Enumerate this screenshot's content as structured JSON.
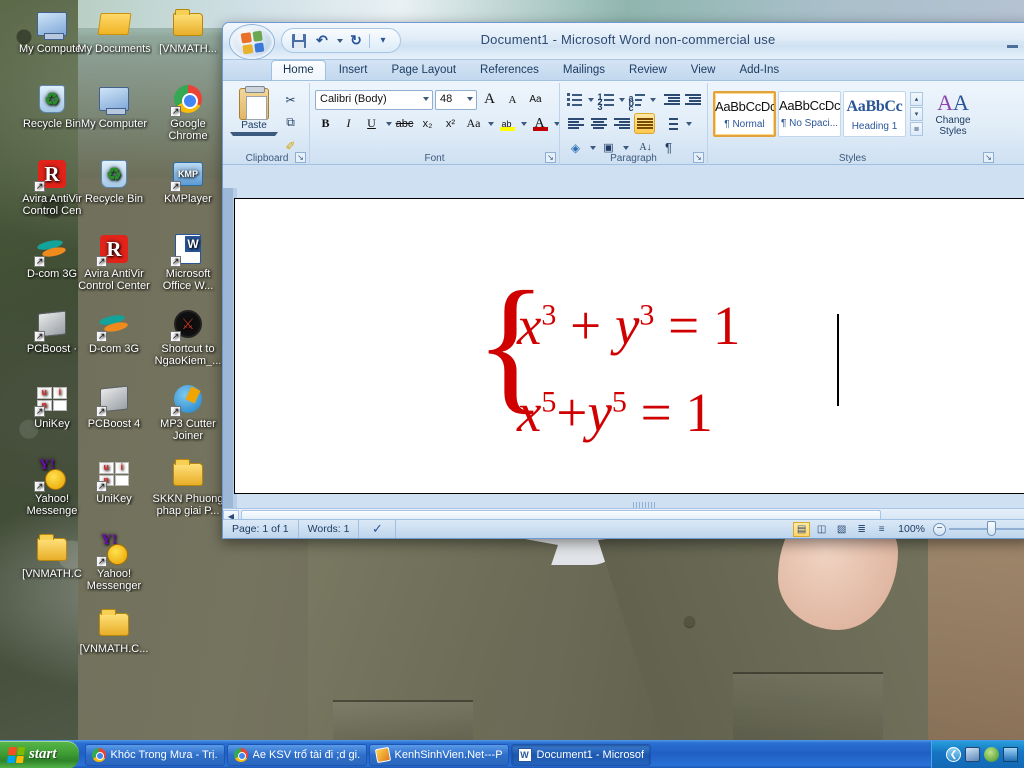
{
  "desktop": {
    "icons": [
      {
        "label": "My Computer",
        "icon": "computer-icon",
        "shortcut": false,
        "col": 0,
        "row": 0
      },
      {
        "label": "My Documents",
        "icon": "folder-open-icon",
        "shortcut": false,
        "col": 1,
        "row": 0
      },
      {
        "label": "[VNMATH...",
        "icon": "folder-icon",
        "shortcut": false,
        "col": 2,
        "row": 0
      },
      {
        "label": "Recycle Bin",
        "icon": "recycle-bin-icon",
        "shortcut": false,
        "col": 0,
        "row": 1
      },
      {
        "label": "My Computer",
        "icon": "computer-icon",
        "shortcut": false,
        "col": 1,
        "row": 1
      },
      {
        "label": "Google Chrome",
        "icon": "chrome-icon",
        "shortcut": true,
        "col": 2,
        "row": 1
      },
      {
        "label": "Avira AntiVir Control Cen",
        "icon": "avira-icon",
        "shortcut": true,
        "col": 0,
        "row": 2
      },
      {
        "label": "Recycle Bin",
        "icon": "recycle-bin-icon",
        "shortcut": false,
        "col": 1,
        "row": 2
      },
      {
        "label": "KMPlayer",
        "icon": "kmplayer-icon",
        "shortcut": true,
        "col": 2,
        "row": 2
      },
      {
        "label": "D-com 3G",
        "icon": "dcom-icon",
        "shortcut": true,
        "col": 0,
        "row": 3
      },
      {
        "label": "Avira AntiVir Control Center",
        "icon": "avira-icon",
        "shortcut": true,
        "col": 1,
        "row": 3
      },
      {
        "label": "Microsoft Office W...",
        "icon": "word-icon",
        "shortcut": true,
        "col": 2,
        "row": 3
      },
      {
        "label": "PCBoost ·",
        "icon": "pcboost-icon",
        "shortcut": true,
        "col": 0,
        "row": 4
      },
      {
        "label": "D-com 3G",
        "icon": "dcom-icon",
        "shortcut": true,
        "col": 1,
        "row": 4
      },
      {
        "label": "Shortcut to NgaoKiem_...",
        "icon": "ngaokiem-icon",
        "shortcut": true,
        "col": 2,
        "row": 4
      },
      {
        "label": "UniKey",
        "icon": "unikey-icon",
        "shortcut": true,
        "col": 0,
        "row": 5
      },
      {
        "label": "PCBoost 4",
        "icon": "pcboost-icon",
        "shortcut": true,
        "col": 1,
        "row": 5
      },
      {
        "label": "MP3 Cutter Joiner",
        "icon": "mp3-cutter-icon",
        "shortcut": true,
        "col": 2,
        "row": 5
      },
      {
        "label": "Yahoo! Messenge",
        "icon": "yahoo-icon",
        "shortcut": true,
        "col": 0,
        "row": 6
      },
      {
        "label": "UniKey",
        "icon": "unikey-icon",
        "shortcut": true,
        "col": 1,
        "row": 6
      },
      {
        "label": "SKKN Phuong phap giai P...",
        "icon": "folder-icon",
        "shortcut": false,
        "col": 2,
        "row": 6
      },
      {
        "label": "[VNMATH.C",
        "icon": "folder-icon",
        "shortcut": false,
        "col": 0,
        "row": 7
      },
      {
        "label": "Yahoo! Messenger",
        "icon": "yahoo-icon",
        "shortcut": true,
        "col": 1,
        "row": 7
      },
      {
        "label": "[VNMATH.C...",
        "icon": "folder-icon",
        "shortcut": false,
        "col": 1,
        "row": 8
      }
    ]
  },
  "word": {
    "title": "Document1 - Microsoft Word non-commercial use",
    "office_button": "office-button",
    "quick_access": [
      {
        "name": "save-button",
        "icon": "save-icon"
      },
      {
        "name": "undo-button",
        "icon": "undo-icon",
        "glyph": "↶"
      },
      {
        "name": "redo-button",
        "icon": "redo-icon",
        "glyph": "↻"
      },
      {
        "name": "customize-qat-button",
        "icon": "chevron-down-icon",
        "glyph": "▾"
      }
    ],
    "minimize_label": "–",
    "tabs": [
      {
        "label": "Home",
        "active": true
      },
      {
        "label": "Insert",
        "active": false
      },
      {
        "label": "Page Layout",
        "active": false
      },
      {
        "label": "References",
        "active": false
      },
      {
        "label": "Mailings",
        "active": false
      },
      {
        "label": "Review",
        "active": false
      },
      {
        "label": "View",
        "active": false
      },
      {
        "label": "Add-Ins",
        "active": false
      }
    ],
    "ribbon": {
      "clipboard": {
        "name": "Clipboard",
        "paste_label": "Paste",
        "cut_glyph": "✂",
        "copy_glyph": "⧉",
        "format_painter_glyph": "✐"
      },
      "font": {
        "name": "Font",
        "font_family_value": "Calibri (Body)",
        "font_size_value": "48",
        "grow_font": "A",
        "shrink_font": "A",
        "clear_formatting": "Aa",
        "bold": "B",
        "italic": "I",
        "underline": "U",
        "strikethrough": "abc",
        "subscript": "x₂",
        "superscript": "x²",
        "change_case": "Aa",
        "highlight": "ab",
        "font_color": "A",
        "highlight_color": "#ffff00",
        "font_color_value": "#c00000"
      },
      "paragraph": {
        "name": "Paragraph",
        "bullets": "bullets-icon",
        "numbering": "numbering-icon",
        "multilevel": "multilevel-list-icon",
        "decrease_indent": "decrease-indent-icon",
        "increase_indent": "increase-indent-icon",
        "align_left": "align-left-icon",
        "align_center": "align-center-icon",
        "align_right": "align-right-icon",
        "justify": "justify-icon",
        "justify_active": true,
        "line_spacing": "line-spacing-icon",
        "shading": "shading-icon",
        "borders": "borders-icon",
        "sort": "sort-icon",
        "sort_label": "A\nZ",
        "show_marks": "¶"
      },
      "styles": {
        "name": "Styles",
        "gallery": [
          {
            "preview": "AaBbCcDc",
            "label": "¶ Normal",
            "selected": true,
            "heading": false
          },
          {
            "preview": "AaBbCcDc",
            "label": "¶ No Spaci...",
            "selected": false,
            "heading": false
          },
          {
            "preview": "AaBbCс",
            "label": "Heading 1",
            "selected": false,
            "heading": true
          }
        ],
        "scroll_up": "▴",
        "scroll_down": "▾",
        "more": "≣",
        "change_styles_label": "Change Styles",
        "change_styles_glyph": "A"
      },
      "dialog_launcher": "↘"
    },
    "document": {
      "equation": {
        "brace": "{",
        "color": "#d00000",
        "lines": [
          {
            "base1": "x",
            "exp1": "3",
            "op": " + ",
            "base2": "y",
            "exp2": "3",
            "eq": " = 1"
          },
          {
            "base1": "x",
            "exp1": "5",
            "op": "+",
            "base2": "y",
            "exp2": "5",
            "eq": " = 1"
          }
        ]
      }
    },
    "status": {
      "page": "Page: 1 of 1",
      "words": "Words: 1",
      "proofing_icon": "spell-check-icon",
      "views": [
        {
          "name": "print-layout-view",
          "glyph": "▤",
          "selected": true
        },
        {
          "name": "full-screen-reading-view",
          "glyph": "◫",
          "selected": false
        },
        {
          "name": "web-layout-view",
          "glyph": "▧",
          "selected": false
        },
        {
          "name": "outline-view",
          "glyph": "≣",
          "selected": false
        },
        {
          "name": "draft-view",
          "glyph": "≡",
          "selected": false
        }
      ],
      "zoom": "100%",
      "zoom_out": "−"
    },
    "scrollbar": {
      "left_arrow": "◀"
    }
  },
  "taskbar": {
    "start_label": "start",
    "items": [
      {
        "label": "Khóc Trong Mưa - Trị...",
        "icon": "chrome-icon",
        "active": false
      },
      {
        "label": "Ae KSV trổ tài đi ;d gi...",
        "icon": "chrome-icon",
        "active": false
      },
      {
        "label": "KenhSinhVien.Net---P...",
        "icon": "orange-doc-icon",
        "active": false
      },
      {
        "label": "Document1 - Microsof...",
        "icon": "word-icon",
        "active": true
      }
    ],
    "tray": [
      {
        "name": "show-hidden-icons-button",
        "icon": "chevron-left-icon",
        "glyph": "❮"
      },
      {
        "name": "network-tray-icon",
        "icon": "network-icon"
      },
      {
        "name": "dcom-tray-icon",
        "icon": "dcom-icon"
      },
      {
        "name": "volume-tray-icon",
        "icon": "volume-icon"
      }
    ]
  }
}
